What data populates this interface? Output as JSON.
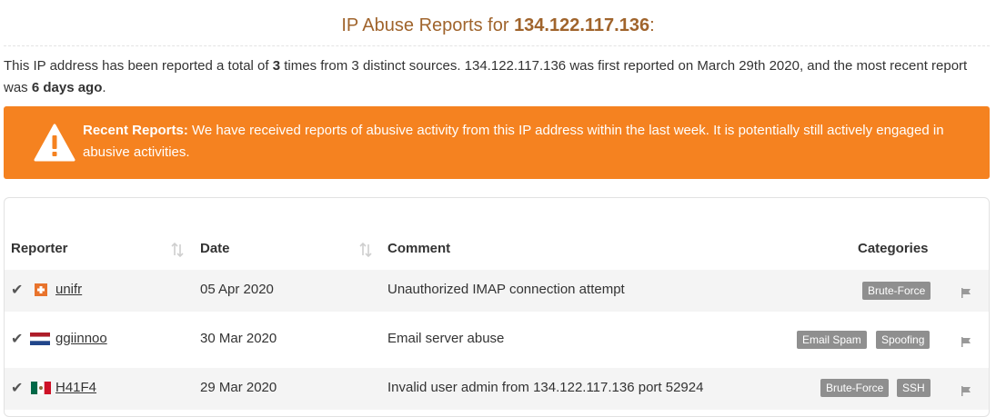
{
  "header": {
    "title_prefix": "IP Abuse Reports for ",
    "ip": "134.122.117.136",
    "title_suffix": ":"
  },
  "summary": {
    "part1": "This IP address has been reported a total of ",
    "count": "3",
    "part2": " times from 3 distinct sources. 134.122.117.136 was first reported on March 29th 2020, and the most recent report was ",
    "recency": "6 days ago",
    "part3": "."
  },
  "alert": {
    "heading": "Recent Reports:",
    "message": " We have received reports of abusive activity from this IP address within the last week. It is potentially still actively engaged in abusive activities.",
    "color": "#f58220"
  },
  "table": {
    "headers": {
      "reporter": "Reporter",
      "date": "Date",
      "comment": "Comment",
      "categories": "Categories"
    },
    "rows": [
      {
        "reporter": "unifr",
        "country": "Switzerland",
        "date": "05 Apr 2020",
        "comment": "Unauthorized IMAP connection attempt",
        "categories": [
          "Brute-Force"
        ]
      },
      {
        "reporter": "ggiinnoo",
        "country": "Netherlands",
        "date": "30 Mar 2020",
        "comment": "Email server abuse",
        "categories": [
          "Email Spam",
          "Spoofing"
        ]
      },
      {
        "reporter": "H41F4",
        "country": "Mexico",
        "date": "29 Mar 2020",
        "comment": "Invalid user admin from 134.122.117.136 port 52924",
        "categories": [
          "Brute-Force",
          "SSH"
        ]
      }
    ]
  },
  "icons": {
    "alert": "warning-triangle-icon",
    "verified": "check-icon",
    "sort": "sort-icon",
    "report": "report-flag-icon"
  }
}
